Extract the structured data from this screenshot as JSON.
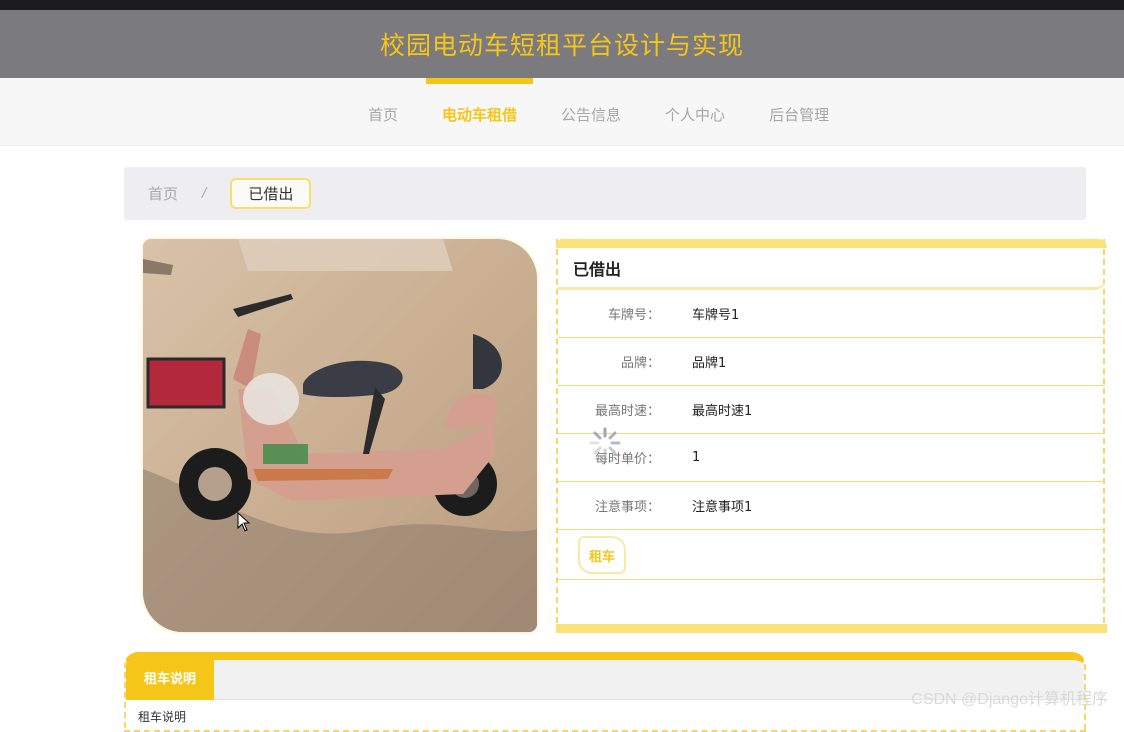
{
  "header": {
    "title": "校园电动车短租平台设计与实现"
  },
  "nav": {
    "items": [
      {
        "label": "首页",
        "active": false
      },
      {
        "label": "电动车租借",
        "active": true
      },
      {
        "label": "公告信息",
        "active": false
      },
      {
        "label": "个人中心",
        "active": false
      },
      {
        "label": "后台管理",
        "active": false
      }
    ]
  },
  "breadcrumb": {
    "home": "首页",
    "separator": "/",
    "current": "已借出"
  },
  "detail": {
    "title": "已借出",
    "fields": [
      {
        "label": "车牌号：",
        "value": "车牌号1"
      },
      {
        "label": "品牌：",
        "value": "品牌1"
      },
      {
        "label": "最高时速：",
        "value": "最高时速1"
      },
      {
        "label": "每时单价：",
        "value": "1"
      },
      {
        "label": "注意事项：",
        "value": "注意事项1"
      }
    ],
    "rent_button": "租车"
  },
  "bottom": {
    "tab_label": "租车说明",
    "peek_text": "租车说明"
  },
  "watermark": "CSDN @Django计算机程序",
  "colors": {
    "accent": "#f5c518",
    "header_bg": "#7b7a7f",
    "border_light": "#f8e9a8"
  },
  "icons": {
    "loading": "loading-spinner-icon",
    "cursor": "mouse-pointer-icon"
  }
}
